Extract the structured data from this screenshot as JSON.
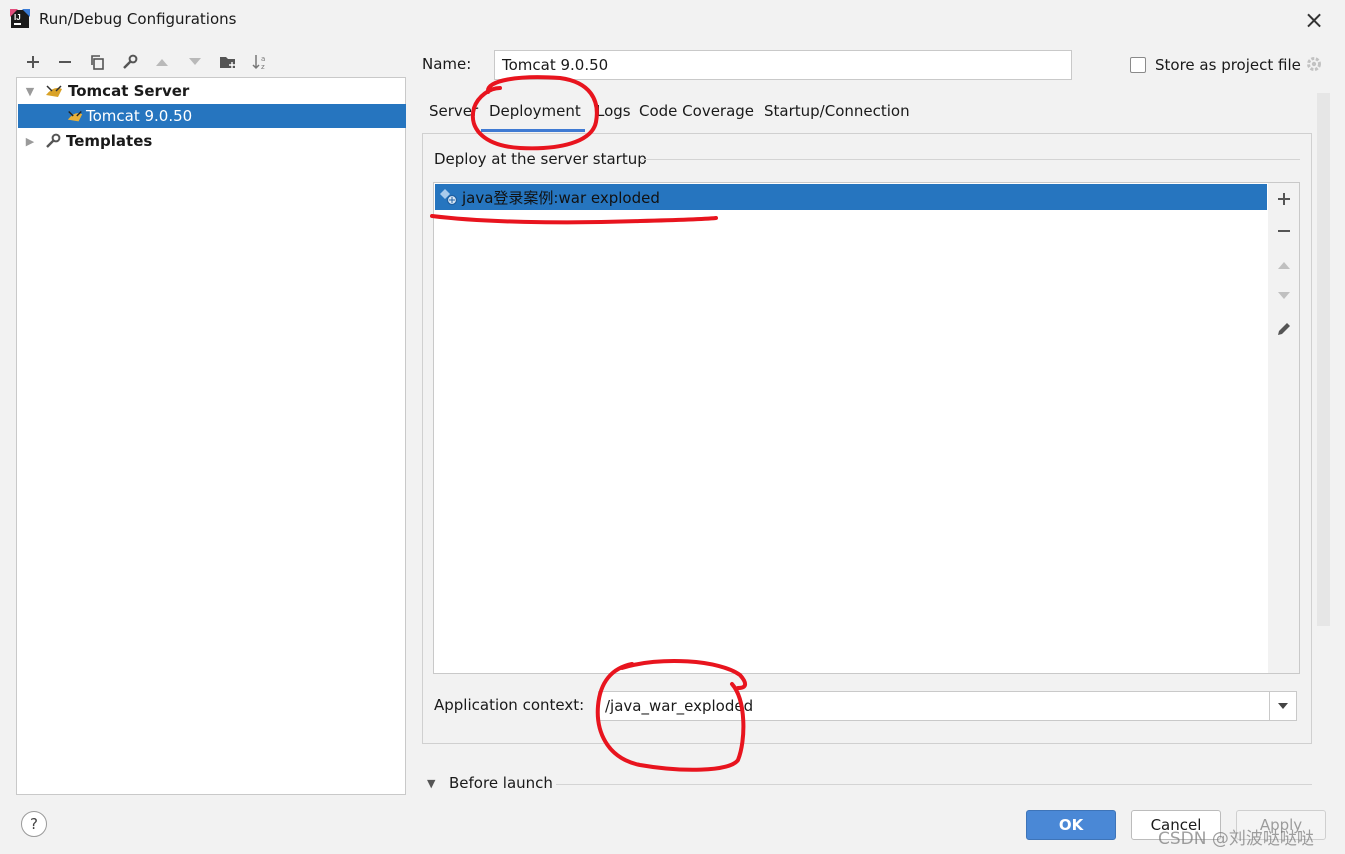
{
  "window": {
    "title": "Run/Debug Configurations"
  },
  "tree": {
    "group_label": "Tomcat Server",
    "config_label": "Tomcat 9.0.50",
    "templates_label": "Templates"
  },
  "form": {
    "name_label": "Name:",
    "name_value": "Tomcat 9.0.50",
    "store_label": "Store as project file",
    "store_checked": false
  },
  "tabs": [
    {
      "label": "Server",
      "selected": false
    },
    {
      "label": "Deployment",
      "selected": true
    },
    {
      "label": "Logs",
      "selected": false
    },
    {
      "label": "Code Coverage",
      "selected": false
    },
    {
      "label": "Startup/Connection",
      "selected": false
    }
  ],
  "deployment": {
    "section_label": "Deploy at the server startup",
    "artifacts": [
      "java登录案例:war exploded"
    ],
    "app_context_label": "Application context:",
    "app_context_value": "/java_war_exploded"
  },
  "before_launch": {
    "label": "Before launch"
  },
  "buttons": {
    "help": "?",
    "ok": "OK",
    "cancel": "Cancel",
    "apply": "Apply"
  },
  "watermark": "CSDN @刘波哒哒哒",
  "colors": {
    "selection": "#2675bf",
    "ok_button": "#4a88d6",
    "annotation": "#e8141e"
  }
}
